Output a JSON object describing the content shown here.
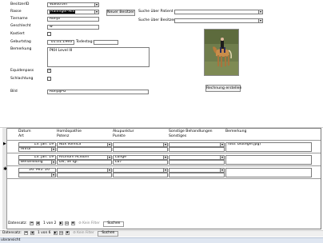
{
  "form": {
    "besitzer_label": "BesitzerID",
    "besitzer_value": "Waldtrom",
    "rasse_label": "Rasse",
    "rasse_value": "Haflinger-Mix",
    "tiername_label": "Tiername",
    "tiername_value": "Ronja",
    "geschlecht_label": "Geschlecht",
    "geschlecht_value": "w",
    "kastiert_label": "Kastiert",
    "kastiert_checked": false,
    "geburtstag_label": "Geburtstag",
    "geburtstag_value": "01.01.1993",
    "todestag_label": "Todestag:",
    "todestag_value": "",
    "bemerkung_label": "Bemerkung",
    "bemerkung_value": "PKH Level III",
    "equidenpass_label": "Equidenpass",
    "equidenpass_checked": true,
    "schlachtung_label": "Schlachtung",
    "schlachtung_checked": false,
    "bild_label": "Bild",
    "bild_value": "RonjaJPG",
    "neuer_besitzer_button": "Neuer Besitzer",
    "suche_patient_label": "Suche über Patient",
    "suche_besitzer_label": "Suche über Besitzer",
    "rechnung_button": "Rechnung erstellen",
    "photo_icon": "horse-rider-photo"
  },
  "subform": {
    "headers_row1": [
      "Datum",
      "Homöopathie",
      "Akupunktur",
      "Sonstige Behandlungen",
      "Bemerkung"
    ],
    "headers_row2": [
      "Art",
      "Potenz",
      "Punkte",
      "Sonstiges"
    ],
    "records": [
      {
        "datum": "13. Jan. 19",
        "homoeo": "Nux vomica",
        "akupunktur": "",
        "sonstige": "",
        "bemerkung": "foto: blutegel.jpg)",
        "art": "Anruf",
        "potenz": "",
        "punkte": "",
        "sonstiges": ""
      },
      {
        "datum": "13. Jan. 19",
        "homoeo": "Ricinum Acidum",
        "akupunktur": "Lunge",
        "sonstige": "",
        "bemerkung": "",
        "art": "Behandlung",
        "potenz": "D6, 3x tgl.",
        "punkte": "Lu7",
        "sonstiges": ""
      },
      {
        "datum": "26. Mrz. 20",
        "homoeo": "",
        "akupunktur": "",
        "sonstige": "",
        "bemerkung": "",
        "art": "",
        "potenz": "",
        "punkte": "",
        "sonstiges": ""
      }
    ],
    "nav_label": "Datensatz:",
    "nav_position": "1 von 2",
    "filter_label": "Kein Filter",
    "search_label": "Suchen"
  },
  "mainnav": {
    "nav_label": "Datensatz:",
    "nav_position": "1 von 6",
    "filter_label": "Kein Filter",
    "search_label": "Suchen"
  },
  "statusbar": {
    "text": "ularansicht"
  }
}
